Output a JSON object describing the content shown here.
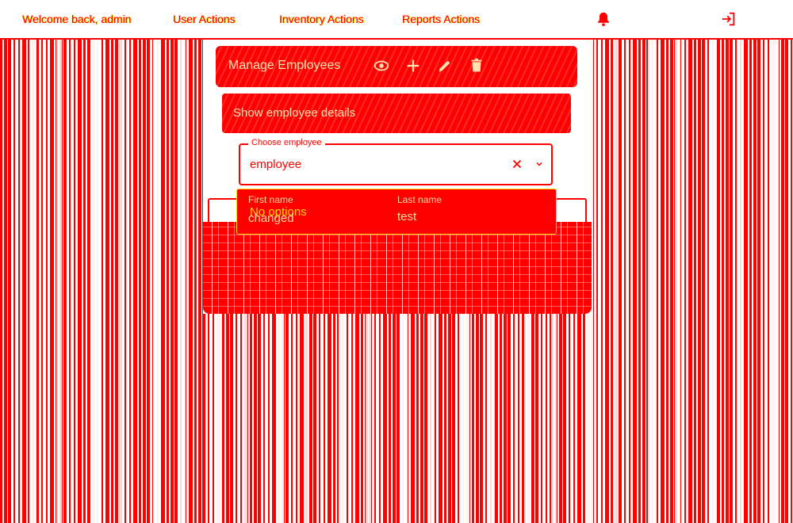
{
  "header": {
    "welcome": "Welcome back, admin",
    "nav": [
      {
        "label": "User Actions"
      },
      {
        "label": "Inventory Actions"
      },
      {
        "label": "Reports Actions"
      }
    ],
    "icons": {
      "notifications": "bell-icon",
      "logout": "logout-icon"
    }
  },
  "card": {
    "title": "Manage Employees",
    "tools": [
      "eye-icon",
      "plus-icon",
      "pencil-icon",
      "trash-icon"
    ]
  },
  "show_details": "Show employee details",
  "combo": {
    "legend": "Choose employee",
    "value": "employee",
    "no_options": "No options"
  },
  "employee": {
    "first_name_label": "First name",
    "first_name": "changed",
    "last_name_label": "Last name",
    "last_name": "test"
  },
  "colors": {
    "primary": "#ff0000",
    "accent": "#ffd400",
    "background": "#ffffff"
  }
}
